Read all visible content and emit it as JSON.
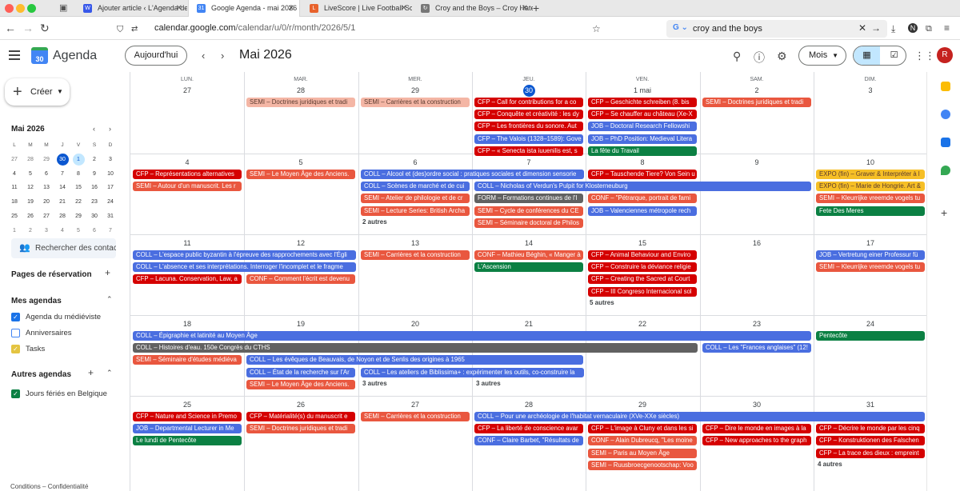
{
  "browser": {
    "tabs": [
      {
        "title": "Ajouter article ‹ L'Agenda des M",
        "icon": "wordpress-icon",
        "color": "#3858e9",
        "glyph": "W"
      },
      {
        "title": "Google Agenda - mai 2026",
        "icon": "calendar-icon",
        "color": "#4285f4",
        "glyph": "31",
        "active": true
      },
      {
        "title": "LiveScore | Live Football Scores",
        "icon": "livescore-icon",
        "color": "#e8622c",
        "glyph": "L"
      },
      {
        "title": "Croy and the Boys – Croy Hates",
        "icon": "loading-icon",
        "color": "#777777",
        "glyph": "↻"
      }
    ],
    "url_path": "/calendar/u/0/r/month/2026/5/1",
    "url_domain": "calendar.google.com",
    "search_query": "croy and the boys"
  },
  "header": {
    "app_name": "Agenda",
    "today_label": "Aujourd'hui",
    "month_label": "Mai 2026",
    "view_label": "Mois",
    "avatar_letter": "R"
  },
  "sidebar": {
    "create_label": "Créer",
    "mini_month": "Mai 2026",
    "mini_headers": [
      "L",
      "M",
      "M",
      "J",
      "V",
      "S",
      "D"
    ],
    "mini_weeks": [
      [
        "27",
        "28",
        "29",
        "30",
        "1",
        "2",
        "3"
      ],
      [
        "4",
        "5",
        "6",
        "7",
        "8",
        "9",
        "10"
      ],
      [
        "11",
        "12",
        "13",
        "14",
        "15",
        "16",
        "17"
      ],
      [
        "18",
        "19",
        "20",
        "21",
        "22",
        "23",
        "24"
      ],
      [
        "25",
        "26",
        "27",
        "28",
        "29",
        "30",
        "31"
      ],
      [
        "1",
        "2",
        "3",
        "4",
        "5",
        "6",
        "7"
      ]
    ],
    "search_people_placeholder": "Rechercher des contacts",
    "booking_pages": "Pages de réservation",
    "my_calendars_title": "Mes agendas",
    "my_calendars": [
      {
        "name": "Agenda du médiéviste",
        "color": "#1a73e8",
        "checked": true
      },
      {
        "name": "Anniversaires",
        "color": "#4285f4",
        "checked": false
      },
      {
        "name": "Tasks",
        "color": "#e4c441",
        "checked": true
      }
    ],
    "other_calendars_title": "Autres agendas",
    "other_calendars": [
      {
        "name": "Jours fériés en Belgique",
        "color": "#0b8043",
        "checked": true
      }
    ],
    "footer": "Conditions – Confidentialité"
  },
  "colors": {
    "red": "#d50000",
    "tomato": "#e9573f",
    "flamingo": "#f4b6a5",
    "blue": "#4a6ee0",
    "grey": "#616161",
    "green": "#0b8043",
    "banana": "#f6bf26",
    "today": "#0b57d0"
  },
  "grid": {
    "weekdays": [
      "LUN.",
      "MAR.",
      "MER.",
      "JEU.",
      "VEN.",
      "SAM.",
      "DIM."
    ],
    "weeks": [
      {
        "days": [
          "27",
          "28",
          "29",
          "30",
          "1 mai",
          "2",
          "3"
        ],
        "today": 3,
        "events": [
          {
            "c": 1,
            "s": 1,
            "r": 0,
            "t": "SEMI – Doctrines juridiques et tradi",
            "k": "flamingo"
          },
          {
            "c": 2,
            "s": 1,
            "r": 0,
            "t": "SEMI – Carrières et la construction",
            "k": "flamingo"
          },
          {
            "c": 3,
            "s": 1,
            "r": 0,
            "t": "CFP – Call for contributions for a co",
            "k": "red"
          },
          {
            "c": 3,
            "s": 1,
            "r": 1,
            "t": "CFP – Conquête et créativité : les dy",
            "k": "red"
          },
          {
            "c": 3,
            "s": 1,
            "r": 2,
            "t": "CFP – Les frontières du sonore. Aut",
            "k": "red"
          },
          {
            "c": 3,
            "s": 1,
            "r": 3,
            "t": "CFP – The Valois (1328–1589): Gove",
            "k": "blue"
          },
          {
            "c": 3,
            "s": 1,
            "r": 4,
            "t": "CFP – « Senecta ista iuuenilis est, s",
            "k": "red"
          },
          {
            "c": 4,
            "s": 1,
            "r": 0,
            "t": "CFP – Geschichte schreiben (8. bis",
            "k": "red"
          },
          {
            "c": 4,
            "s": 1,
            "r": 1,
            "t": "CFP – Se chauffer au château (Xe-X",
            "k": "red"
          },
          {
            "c": 4,
            "s": 1,
            "r": 2,
            "t": "JOB – Doctoral Research Fellowshi",
            "k": "blue"
          },
          {
            "c": 4,
            "s": 1,
            "r": 3,
            "t": "JOB – PhD Position: Medieval Litera",
            "k": "blue"
          },
          {
            "c": 4,
            "s": 1,
            "r": 4,
            "t": "La fête du Travail",
            "k": "green"
          },
          {
            "c": 5,
            "s": 1,
            "r": 0,
            "t": "SEMI – Doctrines juridiques et tradi",
            "k": "tomato"
          }
        ]
      },
      {
        "days": [
          "4",
          "5",
          "6",
          "7",
          "8",
          "9",
          "10"
        ],
        "events": [
          {
            "c": 0,
            "s": 1,
            "r": 0,
            "t": "CFP – Représentations alternatives",
            "k": "red"
          },
          {
            "c": 0,
            "s": 1,
            "r": 1,
            "t": "SEMI – Autour d'un manuscrit. Les r",
            "k": "tomato"
          },
          {
            "c": 1,
            "s": 1,
            "r": 0,
            "t": "SEMI – Le Moyen Âge des Anciens.",
            "k": "tomato"
          },
          {
            "c": 2,
            "s": 2,
            "r": 0,
            "t": "COLL – Alcool et (des)ordre social : pratiques sociales et dimension sensorie",
            "k": "blue"
          },
          {
            "c": 2,
            "s": 1,
            "r": 1,
            "t": "COLL – Scènes de marché et de cui",
            "k": "blue"
          },
          {
            "c": 3,
            "s": 3,
            "r": 1,
            "t": "COLL – Nicholas of Verdun's Pulpit for Klosterneuburg",
            "k": "blue"
          },
          {
            "c": 2,
            "s": 1,
            "r": 2,
            "t": "SEMI – Atelier de philologie et de cr",
            "k": "tomato"
          },
          {
            "c": 2,
            "s": 1,
            "r": 3,
            "t": "SEMI – Lecture Series: British Archa",
            "k": "tomato"
          },
          {
            "c": 3,
            "s": 1,
            "r": 2,
            "t": "FORM – Formations continues de l'I",
            "k": "grey"
          },
          {
            "c": 3,
            "s": 1,
            "r": 3,
            "t": "SEMI – Cycle de conférences du CE",
            "k": "tomato"
          },
          {
            "c": 3,
            "s": 1,
            "r": 4,
            "t": "SEMI – Séminaire doctoral de Philos",
            "k": "tomato"
          },
          {
            "c": 4,
            "s": 1,
            "r": 0,
            "t": "CFP – Tauschende Tiere? Von Sein u",
            "k": "red"
          },
          {
            "c": 4,
            "s": 1,
            "r": 2,
            "t": "CONF – \"Pétrarque, portrait de fami",
            "k": "tomato"
          },
          {
            "c": 4,
            "s": 1,
            "r": 3,
            "t": "JOB – Valenciennes métropole rech",
            "k": "blue"
          },
          {
            "c": 6,
            "s": 1,
            "r": 0,
            "t": "EXPO (fin) – Graver & Interpréter à l",
            "k": "banana"
          },
          {
            "c": 6,
            "s": 1,
            "r": 1,
            "t": "EXPO (fin) – Marie de Hongrie. Art &",
            "k": "banana"
          },
          {
            "c": 6,
            "s": 1,
            "r": 2,
            "t": "SEMI – Kleurrijke vreemde vogels tu",
            "k": "tomato"
          },
          {
            "c": 6,
            "s": 1,
            "r": 3,
            "t": "Fete Des Meres",
            "k": "green"
          }
        ],
        "more": [
          {
            "c": 2,
            "r": 4,
            "t": "2 autres"
          }
        ]
      },
      {
        "days": [
          "11",
          "12",
          "13",
          "14",
          "15",
          "16",
          "17"
        ],
        "events": [
          {
            "c": 0,
            "s": 2,
            "r": 0,
            "t": "COLL – L'espace public byzantin à l'épreuve des rapprochements avec l'Égli",
            "k": "blue"
          },
          {
            "c": 0,
            "s": 2,
            "r": 1,
            "t": "COLL – L'absence et ses interprétations. Interroger l'incomplet et le fragme",
            "k": "blue"
          },
          {
            "c": 0,
            "s": 1,
            "r": 2,
            "t": "CFP – Lacuna. Conservation, Law, a",
            "k": "red"
          },
          {
            "c": 1,
            "s": 1,
            "r": 2,
            "t": "CONF – Comment l'écrit est devenu",
            "k": "tomato"
          },
          {
            "c": 2,
            "s": 1,
            "r": 0,
            "t": "SEMI – Carrières et la construction",
            "k": "tomato"
          },
          {
            "c": 3,
            "s": 1,
            "r": 0,
            "t": "CONF – Mathieu Béghin, « Manger à",
            "k": "tomato"
          },
          {
            "c": 3,
            "s": 1,
            "r": 1,
            "t": "L'Ascension",
            "k": "green"
          },
          {
            "c": 4,
            "s": 1,
            "r": 0,
            "t": "CFP – Animal Behaviour and Enviro",
            "k": "red"
          },
          {
            "c": 4,
            "s": 1,
            "r": 1,
            "t": "CFP – Construire la déviance religie",
            "k": "red"
          },
          {
            "c": 4,
            "s": 1,
            "r": 2,
            "t": "CFP – Creating the Sacred at Court",
            "k": "red"
          },
          {
            "c": 4,
            "s": 1,
            "r": 3,
            "t": "CFP – III Congreso Internacional sol",
            "k": "red"
          },
          {
            "c": 6,
            "s": 1,
            "r": 0,
            "t": "JOB – Vertretung einer Professur fü",
            "k": "blue"
          },
          {
            "c": 6,
            "s": 1,
            "r": 1,
            "t": "SEMI – Kleurrijke vreemde vogels tu",
            "k": "tomato"
          }
        ],
        "more": [
          {
            "c": 4,
            "r": 4,
            "t": "5 autres"
          }
        ]
      },
      {
        "days": [
          "18",
          "19",
          "20",
          "21",
          "22",
          "23",
          "24"
        ],
        "events": [
          {
            "c": 0,
            "s": 6,
            "r": 0,
            "t": "COLL – Épigraphie et latinité au Moyen Âge",
            "k": "blue"
          },
          {
            "c": 0,
            "s": 5,
            "r": 1,
            "t": "COLL – Histoires d'eau. 150e Congrès du CTHS",
            "k": "grey"
          },
          {
            "c": 0,
            "s": 1,
            "r": 2,
            "t": "SEMI – Séminaire d'études médiéva",
            "k": "tomato"
          },
          {
            "c": 1,
            "s": 3,
            "r": 2,
            "t": "COLL – Les évêques de Beauvais, de Noyon et de Senlis des origines à 1965",
            "k": "blue"
          },
          {
            "c": 1,
            "s": 1,
            "r": 3,
            "t": "COLL – État de la recherche sur l'Ar",
            "k": "blue"
          },
          {
            "c": 1,
            "s": 1,
            "r": 4,
            "t": "SEMI – Le Moyen Âge des Anciens.",
            "k": "tomato"
          },
          {
            "c": 2,
            "s": 2,
            "r": 3,
            "t": "COLL – Les ateliers de Biblissima+ : expérimenter les outils, co-construire la",
            "k": "blue"
          },
          {
            "c": 5,
            "s": 1,
            "r": 1,
            "t": "COLL – Les \"Frances anglaises\" (12!",
            "k": "blue"
          },
          {
            "c": 6,
            "s": 1,
            "r": 0,
            "t": "Pentecôte",
            "k": "green"
          }
        ],
        "more": [
          {
            "c": 2,
            "r": 4,
            "t": "3 autres"
          },
          {
            "c": 3,
            "r": 4,
            "t": "3 autres"
          }
        ]
      },
      {
        "days": [
          "25",
          "26",
          "27",
          "28",
          "29",
          "30",
          "31"
        ],
        "events": [
          {
            "c": 0,
            "s": 1,
            "r": 0,
            "t": "CFP – Nature and Science in Premo",
            "k": "red"
          },
          {
            "c": 0,
            "s": 1,
            "r": 1,
            "t": "JOB – Departmental Lecturer in Me",
            "k": "blue"
          },
          {
            "c": 0,
            "s": 1,
            "r": 2,
            "t": "Le lundi de Pentecôte",
            "k": "green"
          },
          {
            "c": 1,
            "s": 1,
            "r": 0,
            "t": "CFP – Matérialité(s) du manuscrit e",
            "k": "red"
          },
          {
            "c": 1,
            "s": 1,
            "r": 1,
            "t": "SEMI – Doctrines juridiques et tradi",
            "k": "tomato"
          },
          {
            "c": 2,
            "s": 1,
            "r": 0,
            "t": "SEMI – Carrières et la construction",
            "k": "tomato"
          },
          {
            "c": 3,
            "s": 4,
            "r": 0,
            "t": "COLL – Pour une archéologie de l'habitat vernaculaire (XVe-XXe siècles)",
            "k": "blue"
          },
          {
            "c": 3,
            "s": 1,
            "r": 1,
            "t": "CFP – La liberté de conscience avar",
            "k": "red"
          },
          {
            "c": 3,
            "s": 1,
            "r": 2,
            "t": "CONF – Claire Barbet, \"Résultats de",
            "k": "blue"
          },
          {
            "c": 4,
            "s": 1,
            "r": 1,
            "t": "CFP – L'image à Cluny et dans les si",
            "k": "red"
          },
          {
            "c": 4,
            "s": 1,
            "r": 2,
            "t": "CONF – Alain Dubreucq, \"Les moine",
            "k": "tomato"
          },
          {
            "c": 4,
            "s": 1,
            "r": 3,
            "t": "SEMI – Paris au Moyen Âge",
            "k": "tomato"
          },
          {
            "c": 4,
            "s": 1,
            "r": 4,
            "t": "SEMI – Ruusbroecgenootschap: Voo",
            "k": "tomato"
          },
          {
            "c": 5,
            "s": 1,
            "r": 1,
            "t": "CFP – Dire le monde en images à la",
            "k": "red"
          },
          {
            "c": 5,
            "s": 1,
            "r": 2,
            "t": "CFP – New approaches to the graph",
            "k": "red"
          },
          {
            "c": 6,
            "s": 1,
            "r": 1,
            "t": "CFP – Décrire le monde par les cinq",
            "k": "red"
          },
          {
            "c": 6,
            "s": 1,
            "r": 2,
            "t": "CFP – Konstruktionen des Falschen",
            "k": "red"
          },
          {
            "c": 6,
            "s": 1,
            "r": 3,
            "t": "CFP – La trace des dieux : empreint",
            "k": "red"
          }
        ],
        "more": [
          {
            "c": 6,
            "r": 4,
            "t": "4 autres"
          }
        ]
      }
    ]
  }
}
